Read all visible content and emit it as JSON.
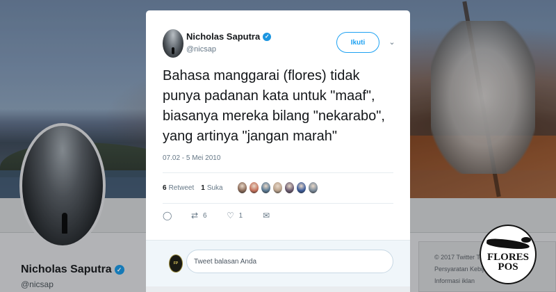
{
  "tweet": {
    "author_name": "Nicholas Saputra",
    "author_handle": "@nicsap",
    "follow_label": "Ikuti",
    "text": "Bahasa manggarai (flores) tidak punya padanan kata untuk \"maaf\", biasanya mereka bilang \"nekarabo\", yang artinya \"jangan marah\"",
    "timestamp": "07.02 - 5 Mei 2010",
    "retweet_count": "6",
    "retweet_label": "Retweet",
    "like_count": "1",
    "like_label": "Suka",
    "action_retweet_count": "6",
    "action_like_count": "1",
    "reply_placeholder": "Tweet balasan Anda",
    "liker_colors": [
      "#8a6a58",
      "#c4705a",
      "#5a7a94",
      "#b8a08a",
      "#6a5a70",
      "#3a5a9a",
      "#7a8a9a"
    ]
  },
  "background_profile": {
    "name": "Nicholas Saputra",
    "handle": "@nicsap",
    "footer_lines": [
      "© 2017 Twitter  Tentang",
      "Persyaratan  Kebijakan priv",
      "Informasi iklan"
    ]
  },
  "logo": {
    "line1": "FLORES",
    "line2": "POS"
  },
  "colors": {
    "accent": "#1da1f2",
    "verified": "#1b95e0",
    "text": "#14171a",
    "muted": "#657786"
  }
}
